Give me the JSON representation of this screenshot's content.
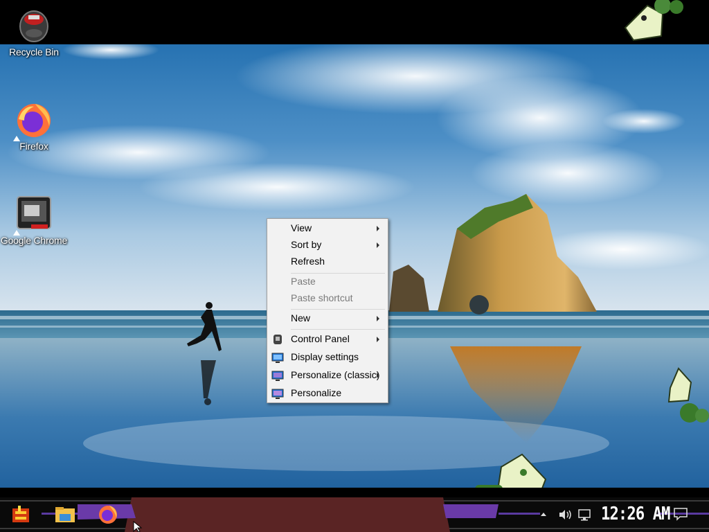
{
  "desktop": {
    "icons": [
      {
        "label": "Recycle Bin",
        "icon": "recycle-bin-icon"
      },
      {
        "label": "Firefox",
        "icon": "firefox-icon"
      },
      {
        "label": "Google Chrome",
        "icon": "chrome-icon"
      }
    ]
  },
  "context_menu": {
    "items": [
      {
        "label": "View",
        "submenu": true,
        "disabled": false,
        "icon": null
      },
      {
        "label": "Sort by",
        "submenu": true,
        "disabled": false,
        "icon": null
      },
      {
        "label": "Refresh",
        "submenu": false,
        "disabled": false,
        "icon": null
      },
      {
        "label": "Paste",
        "submenu": false,
        "disabled": true,
        "icon": null
      },
      {
        "label": "Paste shortcut",
        "submenu": false,
        "disabled": true,
        "icon": null
      },
      {
        "label": "New",
        "submenu": true,
        "disabled": false,
        "icon": null
      },
      {
        "label": "Control Panel",
        "submenu": true,
        "disabled": false,
        "icon": "control-panel-icon"
      },
      {
        "label": "Display settings",
        "submenu": false,
        "disabled": false,
        "icon": "display-settings-icon"
      },
      {
        "label": "Personalize (classic)",
        "submenu": true,
        "disabled": false,
        "icon": "personalize-classic-icon"
      },
      {
        "label": "Personalize",
        "submenu": false,
        "disabled": false,
        "icon": "personalize-icon"
      }
    ]
  },
  "taskbar": {
    "clock": "12:26 AM",
    "pinned": [
      "start-button-icon",
      "file-explorer-icon",
      "firefox-icon"
    ],
    "tray": [
      "show-hidden-icons-chevron",
      "volume-icon",
      "network-icon",
      "notifications-icon"
    ]
  },
  "colors": {
    "taskbar_maroon": "#5a2424",
    "taskbar_purple": "#6a3aa8",
    "menu_bg": "#f2f2f2"
  }
}
